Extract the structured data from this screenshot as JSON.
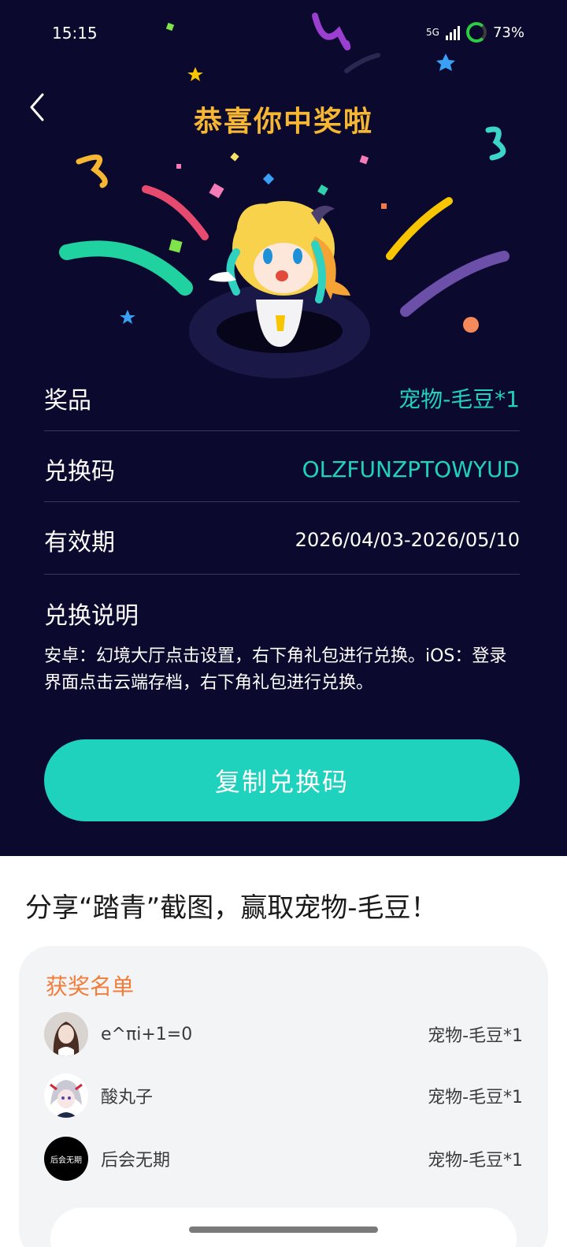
{
  "status": {
    "time": "15:15",
    "battery": "73%",
    "network": "5G"
  },
  "page": {
    "title": "恭喜你中奖啦"
  },
  "prize": {
    "label": "奖品",
    "value": "宠物-毛豆*1",
    "code_label": "兑换码",
    "code_value": "OLZFUNZPTOWYUD",
    "validity_label": "有效期",
    "validity_value": "2026/04/03-2026/05/10",
    "desc_title": "兑换说明",
    "desc_text": "安卓：幻境大厅点击设置，右下角礼包进行兑换。iOS：登录界面点击云端存档，右下角礼包进行兑换。"
  },
  "copy_button": "复制兑换码",
  "share": "分享“踏青”截图，赢取宠物-毛豆！",
  "winners": {
    "title": "获奖名单",
    "items": [
      {
        "name": "e^πi+1=0",
        "prize": "宠物-毛豆*1"
      },
      {
        "name": "酸丸子",
        "prize": "宠物-毛豆*1"
      },
      {
        "name": "后会无期",
        "prize": "宠物-毛豆*1",
        "avatar_text": "后会无期"
      }
    ]
  },
  "colors": {
    "bg_dark": "#0b0a2e",
    "accent": "#1fd2bd",
    "title_gold": "#f7b733",
    "orange": "#f07d3a"
  }
}
